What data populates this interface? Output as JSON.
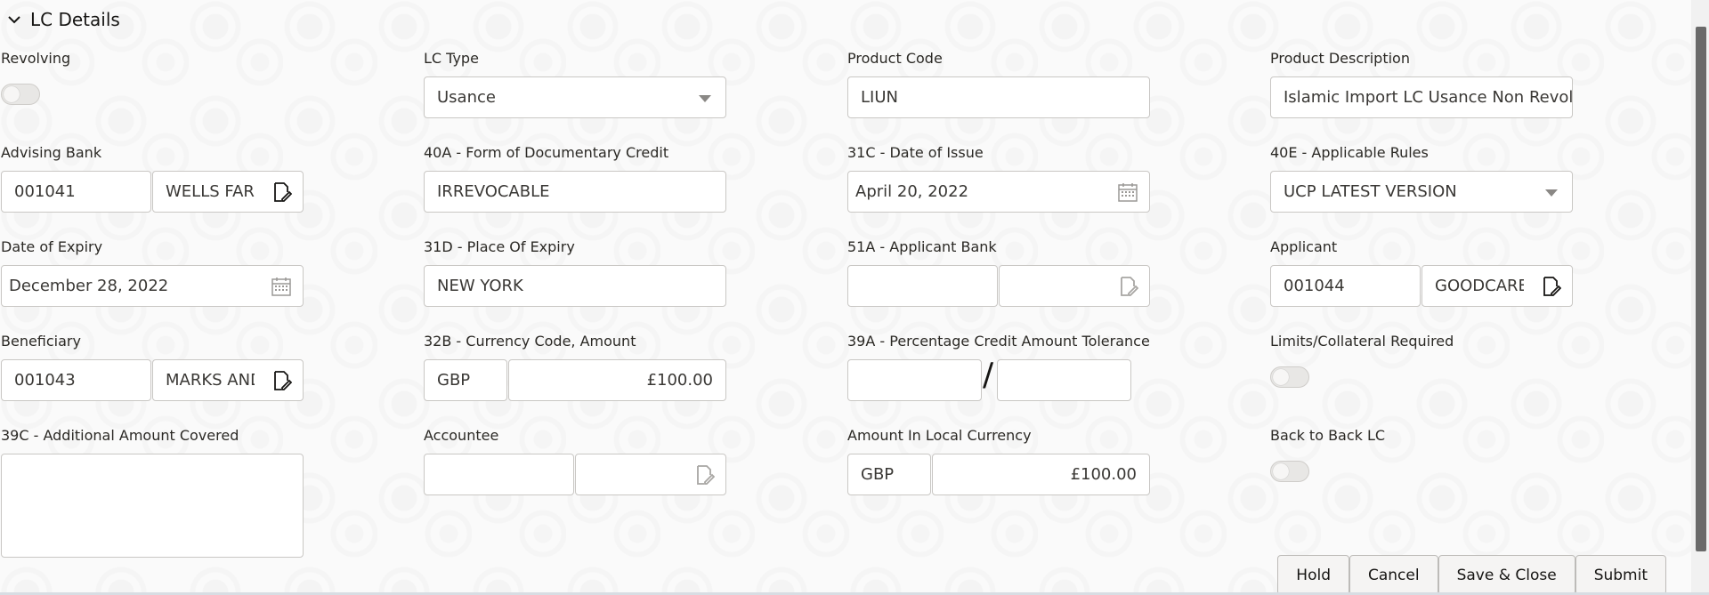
{
  "section": {
    "title": "LC Details"
  },
  "fields": {
    "revolving": {
      "label": "Revolving",
      "on": false
    },
    "lc_type": {
      "label": "LC Type",
      "value": "Usance"
    },
    "product_code": {
      "label": "Product Code",
      "value": "LIUN"
    },
    "product_description": {
      "label": "Product Description",
      "value": "Islamic Import LC Usance Non Revolving"
    },
    "advising_bank": {
      "label": "Advising Bank",
      "code": "001041",
      "name": "WELLS FARGO"
    },
    "form_of_credit": {
      "label": "40A - Form of Documentary Credit",
      "value": "IRREVOCABLE"
    },
    "date_of_issue": {
      "label": "31C - Date of Issue",
      "value": "April 20, 2022"
    },
    "applicable_rules": {
      "label": "40E - Applicable Rules",
      "value": "UCP LATEST VERSION"
    },
    "date_of_expiry": {
      "label": "Date of Expiry",
      "value": "December 28, 2022"
    },
    "place_of_expiry": {
      "label": "31D - Place Of Expiry",
      "value": "NEW YORK"
    },
    "applicant_bank": {
      "label": "51A - Applicant Bank",
      "code": "",
      "name": ""
    },
    "applicant": {
      "label": "Applicant",
      "code": "001044",
      "name": "GOODCARE"
    },
    "beneficiary": {
      "label": "Beneficiary",
      "code": "001043",
      "name": "MARKS AND"
    },
    "currency_amount": {
      "label": "32B - Currency Code, Amount",
      "currency": "GBP",
      "amount": "£100.00"
    },
    "tolerance": {
      "label": "39A - Percentage Credit Amount Tolerance",
      "plus": "",
      "minus": "",
      "separator": "/"
    },
    "limits_required": {
      "label": "Limits/Collateral Required",
      "on": false
    },
    "additional_amount": {
      "label": "39C - Additional Amount Covered",
      "value": ""
    },
    "accountee": {
      "label": "Accountee",
      "code": "",
      "name": ""
    },
    "local_amount": {
      "label": "Amount In Local Currency",
      "currency": "GBP",
      "amount": "£100.00"
    },
    "back_to_back": {
      "label": "Back to Back LC",
      "on": false
    }
  },
  "footer": {
    "hold": "Hold",
    "cancel": "Cancel",
    "save_close": "Save & Close",
    "submit": "Submit"
  },
  "icons": {
    "edit": "edit-document-icon",
    "calendar": "calendar-icon",
    "caret": "chevron-down-icon"
  }
}
